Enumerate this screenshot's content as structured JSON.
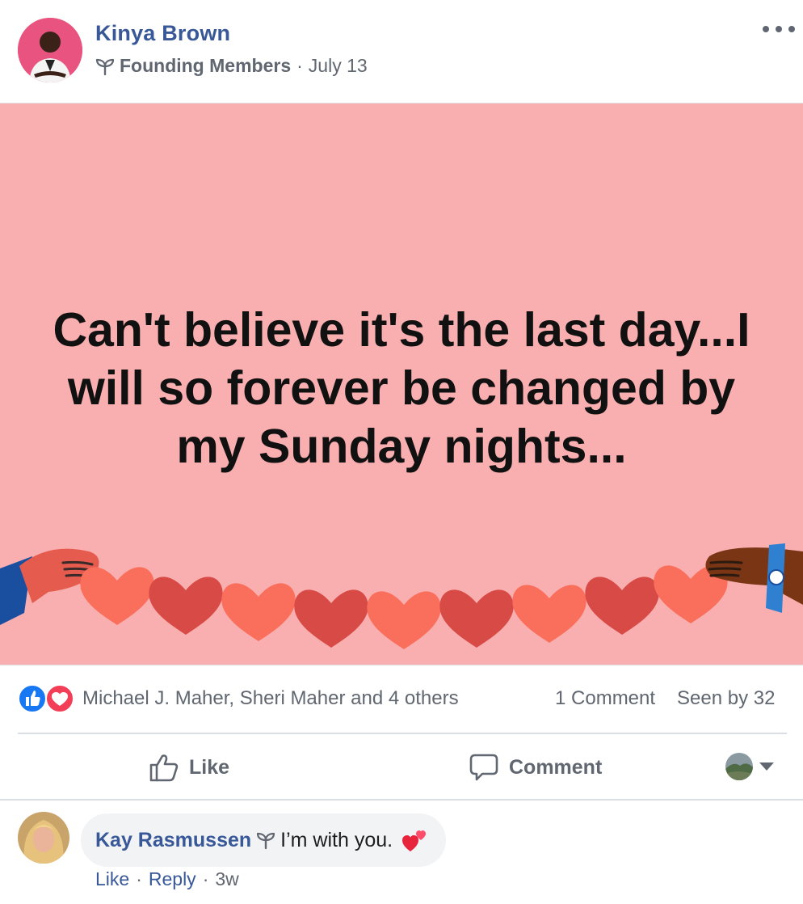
{
  "post": {
    "author_name": "Kinya Brown",
    "group_label": "Founding Members",
    "separator": "·",
    "date": "July 13",
    "banner_text": "Can't believe it's the last day...I will so forever be changed by my Sunday nights..."
  },
  "reactions": {
    "names": "Michael J. Maher, Sheri Maher and 4 others",
    "comments_count": "1 Comment",
    "seen_by": "Seen by 32"
  },
  "actions": {
    "like_label": "Like",
    "comment_label": "Comment"
  },
  "comment": {
    "author_name": "Kay Rasmussen",
    "text": "I’m with you.",
    "like_label": "Like",
    "reply_label": "Reply",
    "separator": "·",
    "age": "3w"
  },
  "colors": {
    "link_blue": "#385898",
    "banner_bg": "#f9aeaf",
    "meta_gray": "#606770",
    "like_blue": "#1877f2",
    "love_red": "#f33e58"
  },
  "icons": {
    "more": "more-options-icon",
    "group": "sprout-icon",
    "like": "thumbs-up-icon",
    "comment": "speech-bubble-icon",
    "reaction_like": "like-reaction-icon",
    "reaction_love": "love-reaction-icon",
    "caret": "caret-down-icon",
    "emoji": "two-hearts-emoji"
  }
}
